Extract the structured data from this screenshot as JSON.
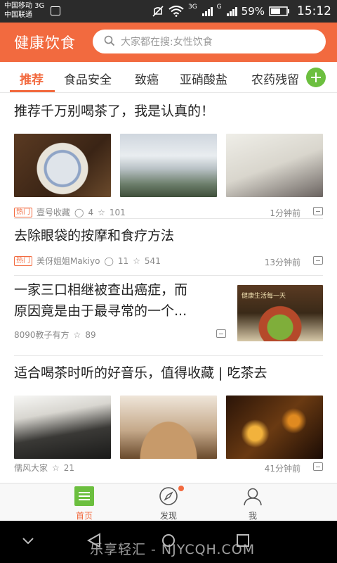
{
  "status_bar": {
    "carrier1": "中国移动 3G",
    "carrier2": "中国联通",
    "net1": "3G",
    "net2": "G",
    "battery": "59%",
    "time": "15:12"
  },
  "header": {
    "title": "健康饮食",
    "search_placeholder": "大家都在搜:女性饮食"
  },
  "tabs": [
    {
      "label": "推荐"
    },
    {
      "label": "食品安全"
    },
    {
      "label": "致癌"
    },
    {
      "label": "亚硝酸盐"
    },
    {
      "label": "农药残留"
    }
  ],
  "feed": [
    {
      "title": "推荐千万别喝茶了，我是认真的！",
      "tag": "热门",
      "source": "壹号收藏",
      "comments": "4",
      "stars": "101",
      "time": "1分钟前"
    },
    {
      "title": "去除眼袋的按摩和食疗方法",
      "tag": "热门",
      "source": "美伢姐姐Makiyo",
      "comments": "11",
      "stars": "541",
      "time": "13分钟前"
    },
    {
      "title_line1": "一家三口相继被查出癌症，而",
      "title_line2": "原因竟是由于最寻常的一个...",
      "source": "8090教子有方",
      "stars": "89",
      "image_caption": "健康生活每一天"
    },
    {
      "title": "适合喝茶时听的好音乐，值得收藏 | 吃茶去",
      "source": "儒风大家",
      "stars": "21",
      "time": "41分钟前"
    }
  ],
  "bottom_nav": [
    {
      "label": "首页"
    },
    {
      "label": "发现"
    },
    {
      "label": "我"
    }
  ],
  "watermark": "乐享轻汇 - NJYCQH.COM",
  "colors": {
    "accent": "#f26a3f",
    "add_button": "#6cbf3f",
    "status_bar": "#2b2b2b"
  }
}
